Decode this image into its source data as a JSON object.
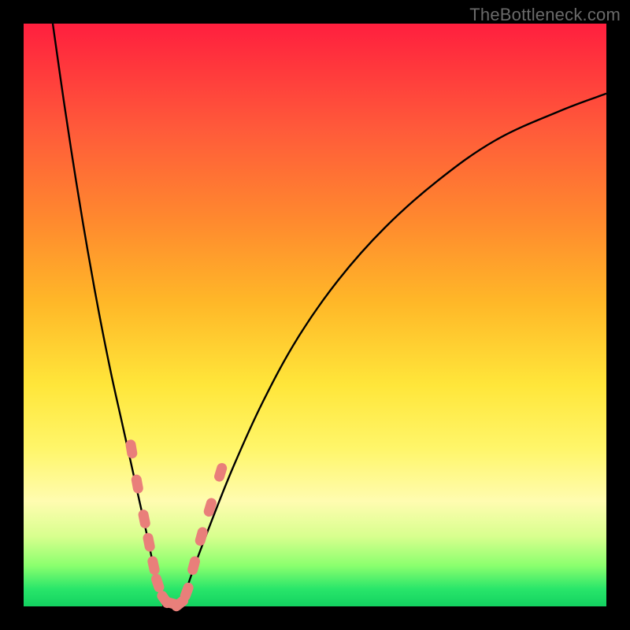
{
  "watermark": "TheBottleneck.com",
  "colors": {
    "frame": "#000000",
    "gradient_top": "#ff1f3e",
    "gradient_bottom": "#13d160",
    "curve": "#000000",
    "markers": "#e97f7a"
  },
  "chart_data": {
    "type": "line",
    "title": "",
    "xlabel": "",
    "ylabel": "",
    "xlim": [
      0,
      100
    ],
    "ylim": [
      0,
      100
    ],
    "grid": false,
    "annotations": [
      "TheBottleneck.com"
    ],
    "notes": "Bottleneck-style V-curve. Y maps to color band: 0 = green (bottom), 100 = red (top). No numeric axis ticks shown; values are read from vertical position and estimated.",
    "series": [
      {
        "name": "left-branch",
        "x": [
          5,
          7,
          9,
          11,
          13,
          15,
          17,
          19,
          21,
          22.5,
          24
        ],
        "y": [
          100,
          86,
          73,
          61,
          50,
          40,
          31,
          22,
          13,
          6,
          0
        ]
      },
      {
        "name": "right-branch",
        "x": [
          27,
          29,
          32,
          36,
          41,
          47,
          54,
          62,
          71,
          81,
          92,
          100
        ],
        "y": [
          0,
          6,
          14,
          24,
          35,
          46,
          56,
          65,
          73,
          80,
          85,
          88
        ]
      }
    ],
    "markers": {
      "name": "highlighted-points",
      "shape": "rounded-capsule",
      "color": "#e97f7a",
      "points": [
        {
          "x": 18.5,
          "y": 27
        },
        {
          "x": 19.5,
          "y": 21
        },
        {
          "x": 20.7,
          "y": 15
        },
        {
          "x": 21.5,
          "y": 11
        },
        {
          "x": 22.3,
          "y": 7
        },
        {
          "x": 23.0,
          "y": 4
        },
        {
          "x": 24.2,
          "y": 1.2
        },
        {
          "x": 25.5,
          "y": 0.5
        },
        {
          "x": 26.8,
          "y": 0.5
        },
        {
          "x": 28.0,
          "y": 2.5
        },
        {
          "x": 29.2,
          "y": 7
        },
        {
          "x": 30.5,
          "y": 12
        },
        {
          "x": 32.0,
          "y": 17
        },
        {
          "x": 33.8,
          "y": 23
        }
      ]
    }
  }
}
